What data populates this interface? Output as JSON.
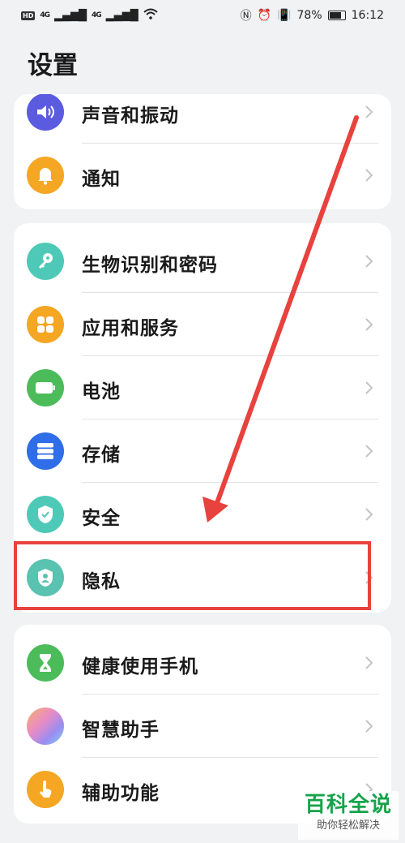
{
  "status_bar": {
    "hd": "HD",
    "signal1": "4G",
    "signal2": "4G",
    "battery": "78%",
    "time": "16:12"
  },
  "page_title": "设置",
  "groups": [
    [
      {
        "label": "声音和振动",
        "icon": "speaker-icon",
        "color": "#5b5be0"
      },
      {
        "label": "通知",
        "icon": "bell-icon",
        "color": "#f5a623"
      }
    ],
    [
      {
        "label": "生物识别和密码",
        "icon": "key-icon",
        "color": "#4ec9b8"
      },
      {
        "label": "应用和服务",
        "icon": "apps-grid-icon",
        "color": "#f5a623"
      },
      {
        "label": "电池",
        "icon": "battery-icon",
        "color": "#4cbc5a"
      },
      {
        "label": "存储",
        "icon": "storage-icon",
        "color": "#2f6ee8"
      },
      {
        "label": "安全",
        "icon": "shield-check-icon",
        "color": "#4ec9b8"
      },
      {
        "label": "隐私",
        "icon": "privacy-shield-icon",
        "color": "#5ac2b0"
      }
    ],
    [
      {
        "label": "健康使用手机",
        "icon": "hourglass-icon",
        "color": "#4cbc5a"
      },
      {
        "label": "智慧助手",
        "icon": "assistant-orb-icon",
        "color": "#c59be8"
      },
      {
        "label": "辅助功能",
        "icon": "hand-icon",
        "color": "#f5a623"
      }
    ]
  ],
  "annotation_color": "#e8423e",
  "watermark": {
    "main": "百科全说",
    "sub": "助你轻松解决"
  }
}
